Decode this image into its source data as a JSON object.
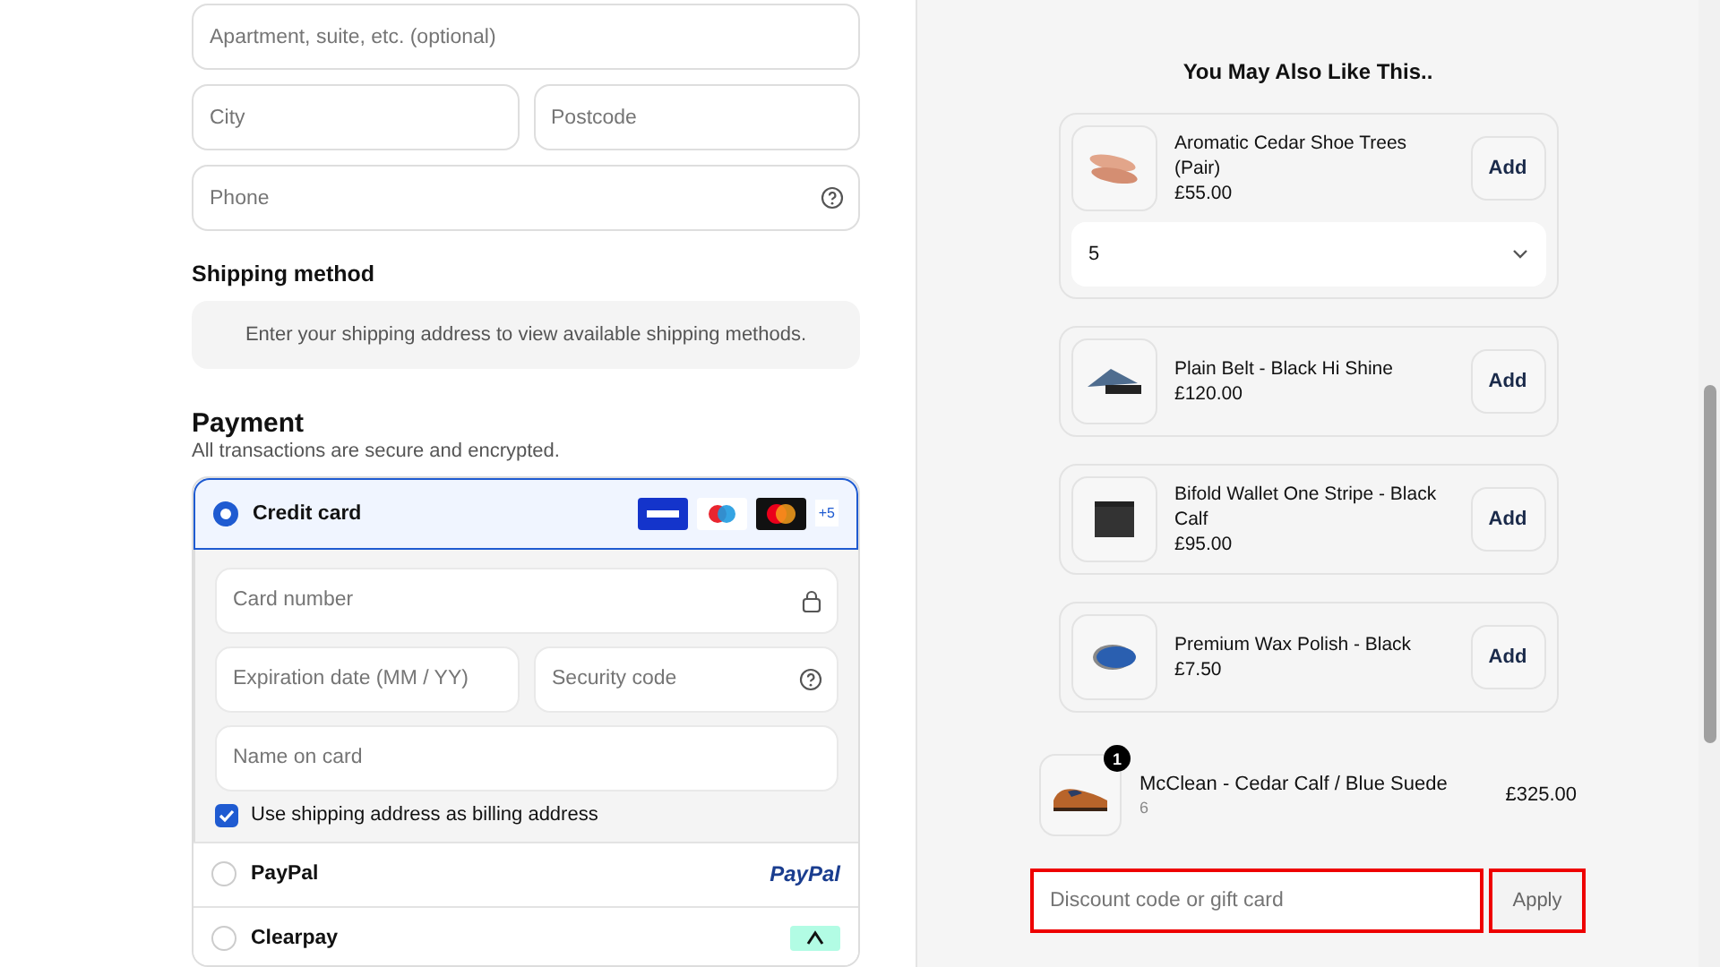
{
  "address_fields": [
    {
      "placeholder": "Apartment, suite, etc. (optional)"
    },
    {
      "row": [
        {
          "placeholder": "City"
        },
        {
          "placeholder": "Postcode"
        }
      ]
    },
    {
      "placeholder": "Phone"
    }
  ],
  "shipping": {
    "title": "Shipping method",
    "notice": "Enter your shipping address to view available shipping methods."
  },
  "payment": {
    "title": "Payment",
    "subtitle": "All transactions are secure and encrypted.",
    "methods": [
      {
        "label": "Credit card",
        "selected": true,
        "more": "+5",
        "fields": [
          {
            "placeholder": "Card number"
          },
          {
            "row": [
              {
                "placeholder": "Expiration date (MM / YY)"
              },
              {
                "placeholder": "Security code"
              }
            ]
          },
          {
            "placeholder": "Name on card"
          }
        ],
        "billing": {
          "label": "Use shipping address as billing address",
          "checked": true
        }
      },
      {
        "label": "PayPal",
        "selected": false,
        "logo_text": "PayPal"
      },
      {
        "label": "Clearpay",
        "selected": false
      }
    ]
  },
  "upsell": {
    "title": "You May Also Like This..",
    "items": [
      {
        "name": "Aromatic Cedar Shoe Trees (Pair)",
        "price": "£55.00",
        "button": "Add",
        "quantity": "5"
      },
      {
        "name": "Plain Belt - Black Hi Shine",
        "price": "£120.00",
        "button": "Add"
      },
      {
        "name": "Bifold Wallet One Stripe - Black Calf",
        "price": "£95.00",
        "button": "Add"
      },
      {
        "name": "Premium Wax Polish - Black",
        "price": "£7.50",
        "button": "Add"
      }
    ]
  },
  "cart_item": {
    "name": "McClean - Cedar Calf / Blue Suede",
    "variant": "6",
    "price": "£325.00",
    "quantity": "1"
  },
  "discount": {
    "placeholder": "Discount code or gift card",
    "button": "Apply",
    "highlighted": true
  }
}
